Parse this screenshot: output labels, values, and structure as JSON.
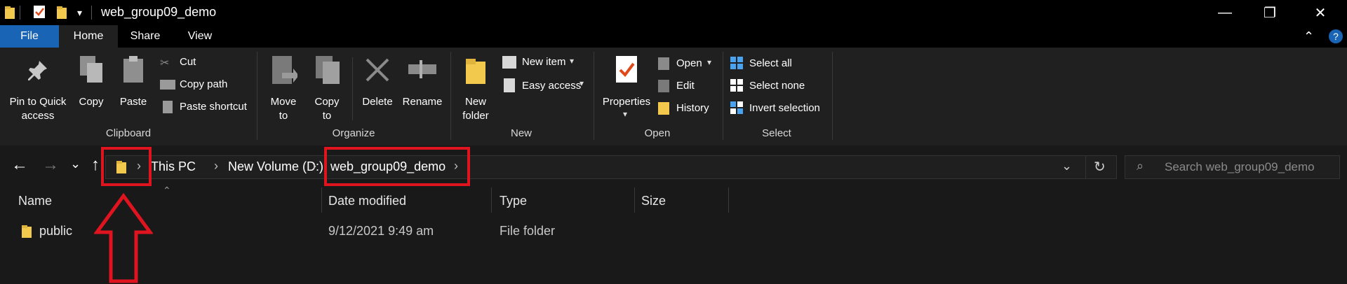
{
  "window": {
    "title": "web_group09_demo",
    "controls": {
      "minimize": "—",
      "maximize": "❐",
      "close": "✕"
    }
  },
  "ribbon_tabs": [
    "File",
    "Home",
    "Share",
    "View"
  ],
  "ribbon": {
    "clipboard": {
      "pin_line1": "Pin to Quick",
      "pin_line2": "access",
      "copy": "Copy",
      "paste": "Paste",
      "cut": "Cut",
      "copy_path": "Copy path",
      "paste_shortcut": "Paste shortcut",
      "label": "Clipboard"
    },
    "organize": {
      "move_to_line1": "Move",
      "move_to_line2": "to",
      "copy_to_line1": "Copy",
      "copy_to_line2": "to",
      "delete": "Delete",
      "rename": "Rename",
      "label": "Organize"
    },
    "new": {
      "new_folder_line1": "New",
      "new_folder_line2": "folder",
      "new_item": "New item",
      "easy_access": "Easy access",
      "label": "New"
    },
    "open": {
      "properties": "Properties",
      "open": "Open",
      "edit": "Edit",
      "history": "History",
      "label": "Open"
    },
    "select": {
      "select_all": "Select all",
      "select_none": "Select none",
      "invert_selection": "Invert selection",
      "label": "Select"
    }
  },
  "address": {
    "crumbs": [
      "This PC",
      "New Volume (D:)",
      "web_group09_demo"
    ],
    "search_placeholder": "Search web_group09_demo"
  },
  "columns": [
    "Name",
    "Date modified",
    "Type",
    "Size"
  ],
  "files": [
    {
      "name": "public",
      "date_modified": "9/12/2021 9:49 am",
      "type": "File folder",
      "size": ""
    }
  ],
  "colors": {
    "file_tab": "#1a64b5",
    "highlight": "#e0141e",
    "folder": "#f2c94c"
  }
}
